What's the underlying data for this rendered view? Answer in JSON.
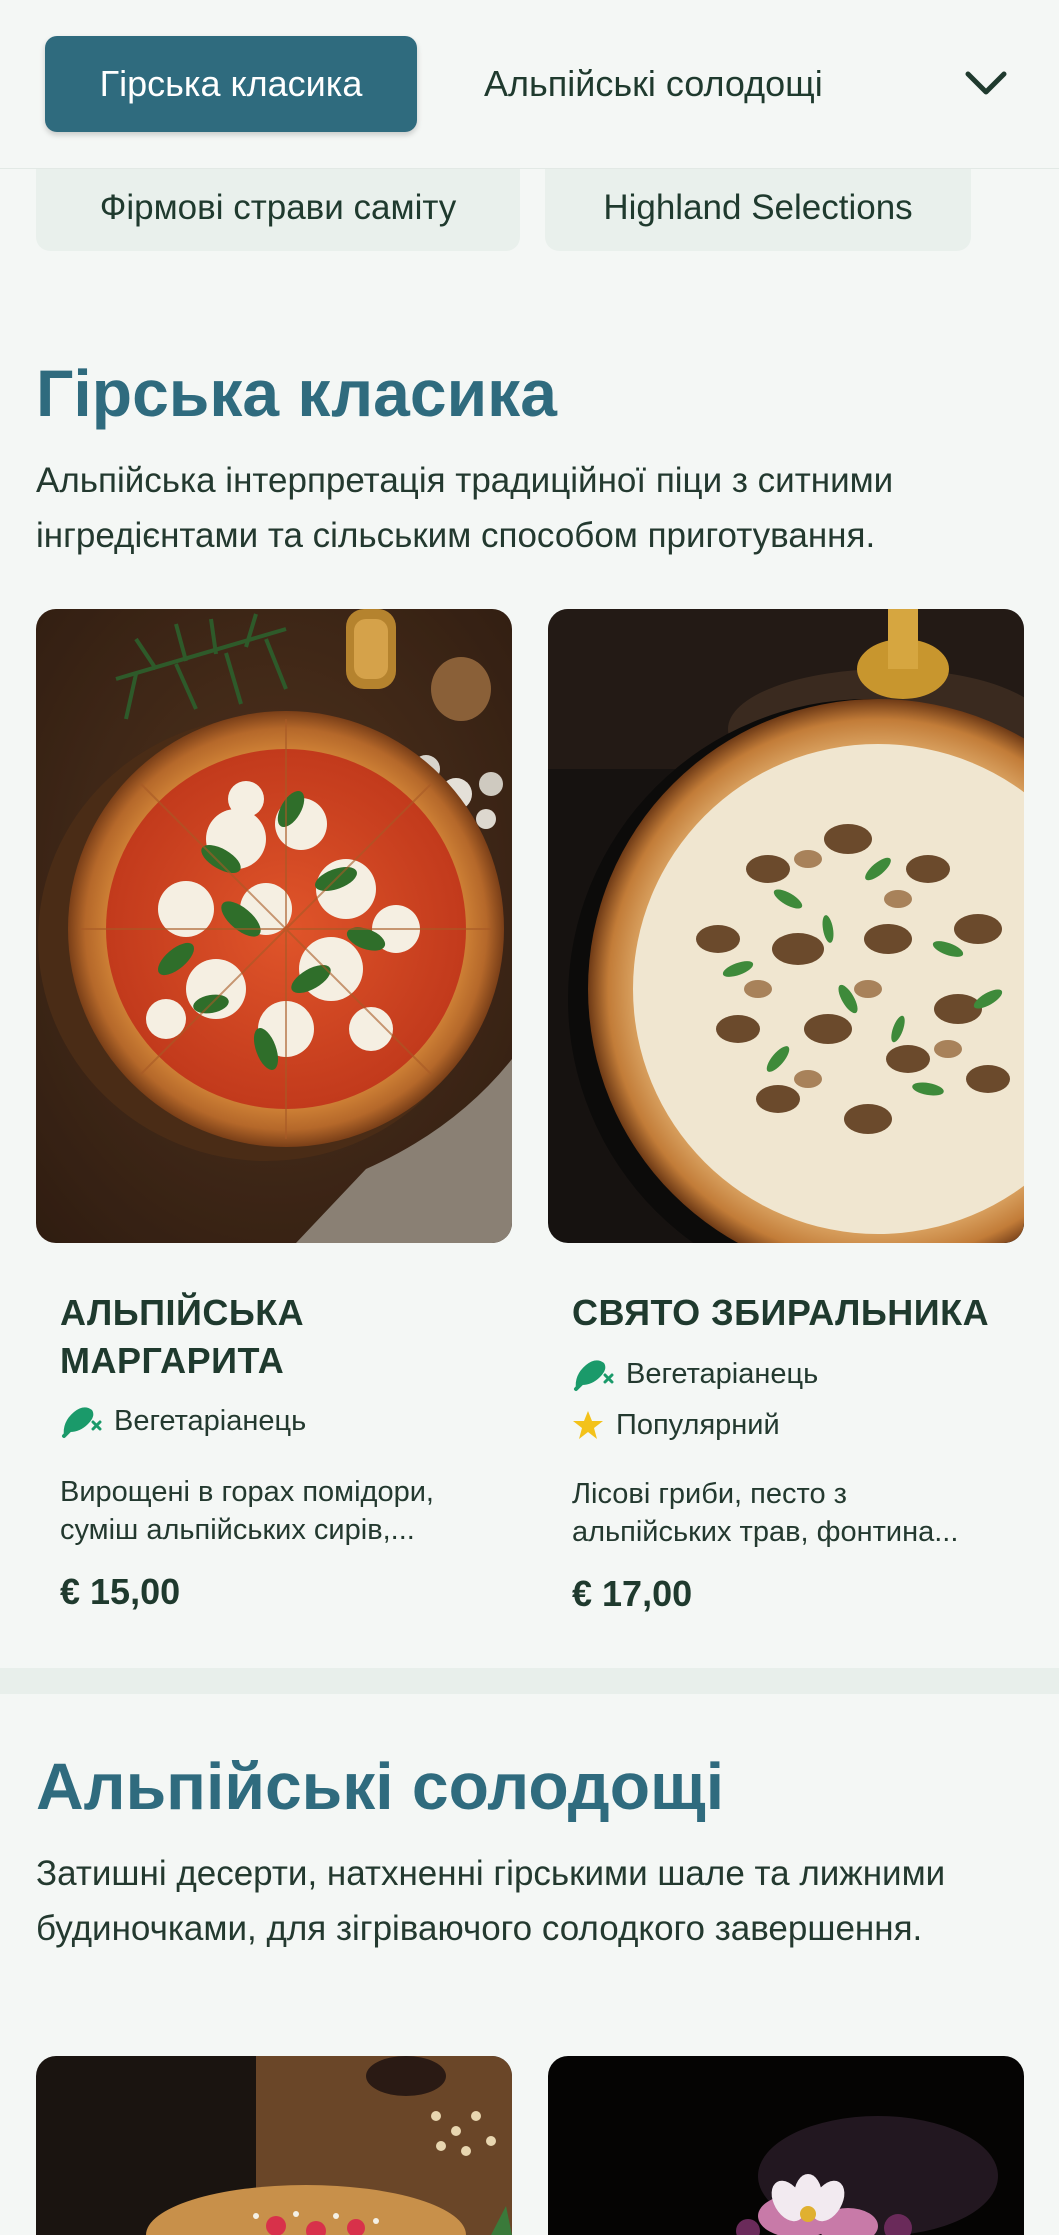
{
  "nav": {
    "active_tab": "Гірська класика",
    "next_tab": "Альпійські солодощі",
    "subtabs": [
      "Фірмові страви саміту",
      "Highland Selections"
    ]
  },
  "sections": [
    {
      "title": "Гірська класика",
      "description": "Альпійська інтерпретація традиційної піци з ситними інгредієнтами та сільським способом приготування.",
      "items": [
        {
          "name": "Альпійська маргарита",
          "tags": [
            "Вегетаріанець"
          ],
          "description": "Вирощені в горах помідори, суміш альпійських сирів,...",
          "price": "€ 15,00"
        },
        {
          "name": "Свято збиральника",
          "tags": [
            "Вегетаріанець",
            "Популярний"
          ],
          "description": "Лісові гриби, песто з альпійських трав, фонтина...",
          "price": "€ 17,00"
        }
      ]
    },
    {
      "title": "Альпійські солодощі",
      "description": "Затишні десерти, натхненні гірськими шале та лижними будиночками, для зігріваючого солодкого завершення."
    }
  ],
  "colors": {
    "accent": "#2f6b7e",
    "background": "#f4f7f5",
    "chip_background": "#e9f0ec",
    "vegetarian_icon": "#1a9a6a",
    "popular_icon": "#f3c21a"
  },
  "icons": {
    "vegetarian": "leaf-drumstick-icon",
    "popular": "star-icon",
    "dropdown": "chevron-down-icon"
  }
}
